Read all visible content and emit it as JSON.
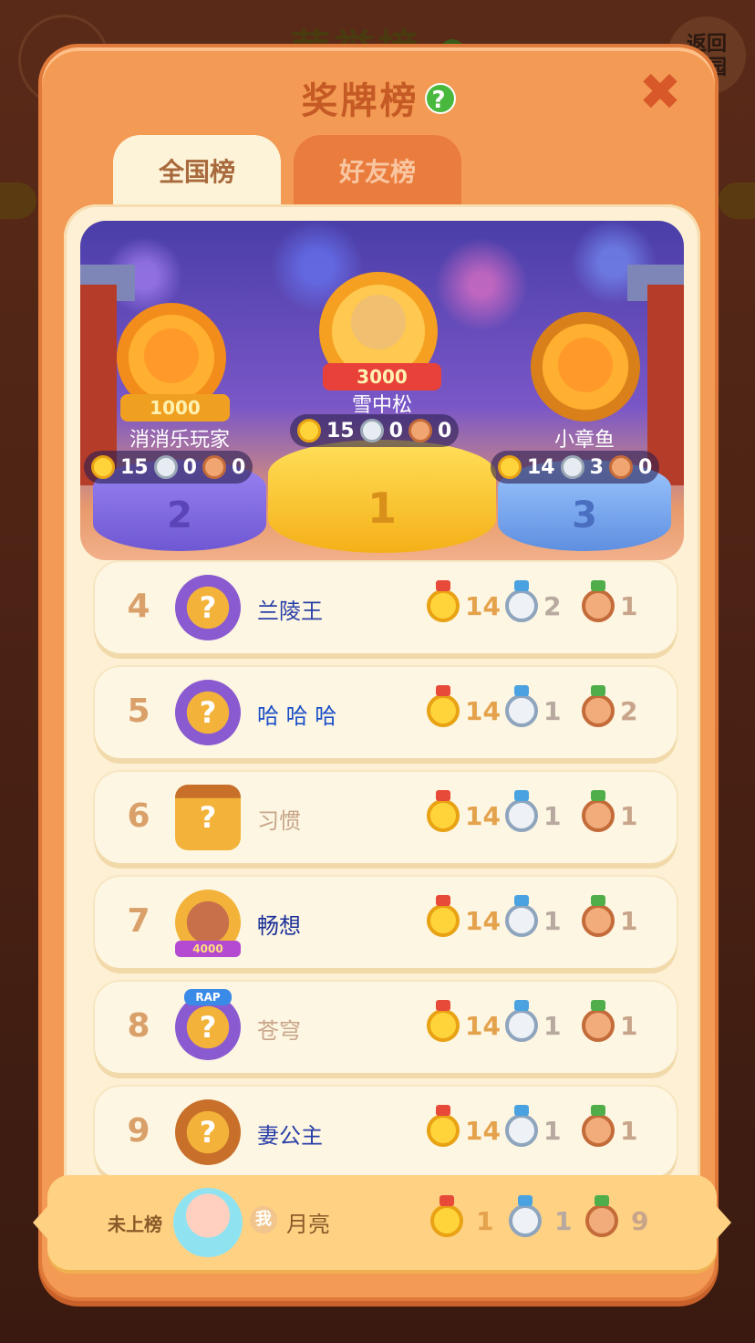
{
  "background": {
    "title": "荣誉榜",
    "back_label_line1": "返回",
    "back_label_line2": "家园"
  },
  "modal": {
    "title": "奖牌榜",
    "help_icon": "?",
    "close_icon": "✖"
  },
  "tabs": [
    {
      "label": "全国榜",
      "active": true
    },
    {
      "label": "好友榜",
      "active": false
    }
  ],
  "podium": [
    {
      "rank": "2",
      "name": "消消乐玩家",
      "badge": "1000",
      "gold": "15",
      "silver": "0",
      "bronze": "0"
    },
    {
      "rank": "1",
      "name": "雪中松",
      "badge": "3000",
      "gold": "15",
      "silver": "0",
      "bronze": "0"
    },
    {
      "rank": "3",
      "name": "小章鱼",
      "badge": "",
      "gold": "14",
      "silver": "3",
      "bronze": "0"
    }
  ],
  "rows": [
    {
      "rank": "4",
      "name": "兰陵王",
      "gold": "14",
      "silver": "2",
      "bronze": "1",
      "name_color": "#2a3fa8"
    },
    {
      "rank": "5",
      "name": "哈 哈 哈",
      "gold": "14",
      "silver": "1",
      "bronze": "2",
      "name_color": "#1a4fc8"
    },
    {
      "rank": "6",
      "name": "习惯",
      "gold": "14",
      "silver": "1",
      "bronze": "1",
      "name_color": "#c8a58a"
    },
    {
      "rank": "7",
      "name": "畅想",
      "gold": "14",
      "silver": "1",
      "bronze": "1",
      "name_color": "#1a2f98",
      "badge": "4000"
    },
    {
      "rank": "8",
      "name": "苍穹",
      "gold": "14",
      "silver": "1",
      "bronze": "1",
      "name_color": "#c8a58a",
      "badge": "RAP"
    },
    {
      "rank": "9",
      "name": "妻公主",
      "gold": "14",
      "silver": "1",
      "bronze": "1",
      "name_color": "#2a3fa8"
    }
  ],
  "me": {
    "rank_label": "未上榜",
    "me_badge": "我",
    "name": "月亮",
    "gold": "1",
    "silver": "1",
    "bronze": "9"
  },
  "colors": {
    "modal_bg": "#f39a54",
    "panel_bg": "#fdf0d4",
    "title": "#c55a25"
  }
}
